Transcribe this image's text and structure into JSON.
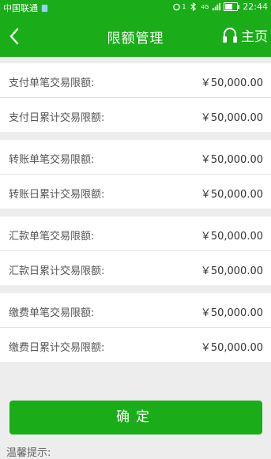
{
  "status_bar": {
    "carrier": "中国联通",
    "sim_badge": "1",
    "network": "4G",
    "time": "22:44"
  },
  "header": {
    "title": "限额管理",
    "home_label": "主页"
  },
  "groups": [
    {
      "rows": [
        {
          "label": "支付单笔交易限额:",
          "value": "￥50,000.00"
        },
        {
          "label": "支付日累计交易限额:",
          "value": "￥50,000.00"
        }
      ]
    },
    {
      "rows": [
        {
          "label": "转账单笔交易限额:",
          "value": "￥50,000.00"
        },
        {
          "label": "转账日累计交易限额:",
          "value": "￥50,000.00"
        }
      ]
    },
    {
      "rows": [
        {
          "label": "汇款单笔交易限额:",
          "value": "￥50,000.00"
        },
        {
          "label": "汇款日累计交易限额:",
          "value": "￥50,000.00"
        }
      ]
    },
    {
      "rows": [
        {
          "label": "缴费单笔交易限额:",
          "value": "￥50,000.00"
        },
        {
          "label": "缴费日累计交易限额:",
          "value": "￥50,000.00"
        }
      ]
    }
  ],
  "confirm_label": "确定",
  "tip_label": "温馨提示:",
  "colors": {
    "brand_green": "#1aad19",
    "background": "#ededed"
  }
}
